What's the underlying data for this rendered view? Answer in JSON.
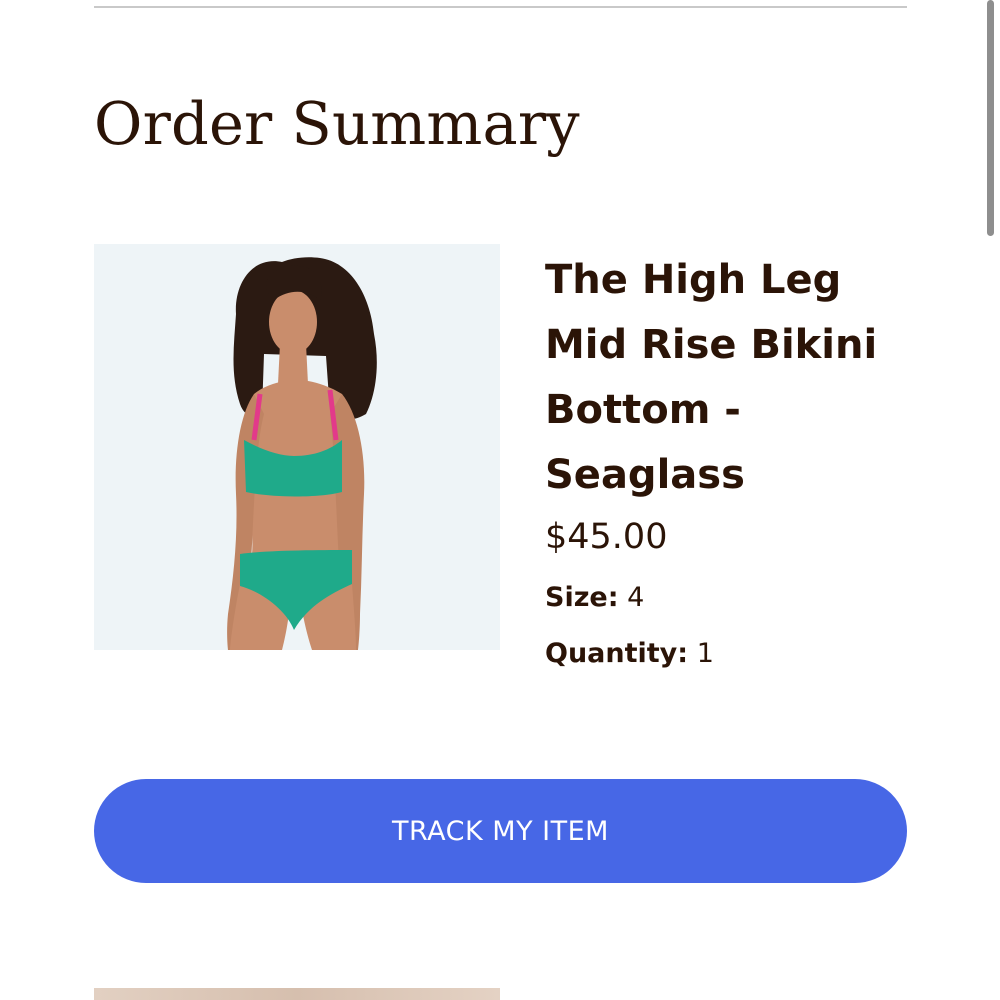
{
  "order_summary": {
    "title": "Order Summary"
  },
  "product": {
    "name": "The High Leg Mid Rise Bikini Bottom - Seaglass",
    "price": "$45.00",
    "size_label": "Size:",
    "size_value": "4",
    "quantity_label": "Quantity:",
    "quantity_value": "1",
    "image_alt": "Model wearing seaglass bikini"
  },
  "actions": {
    "track_label": "TRACK MY ITEM"
  },
  "colors": {
    "text": "#2b1407",
    "button": "#4767e6",
    "button_text": "#ffffff",
    "swimsuit": "#1faa8a",
    "strap": "#e23a8a"
  }
}
